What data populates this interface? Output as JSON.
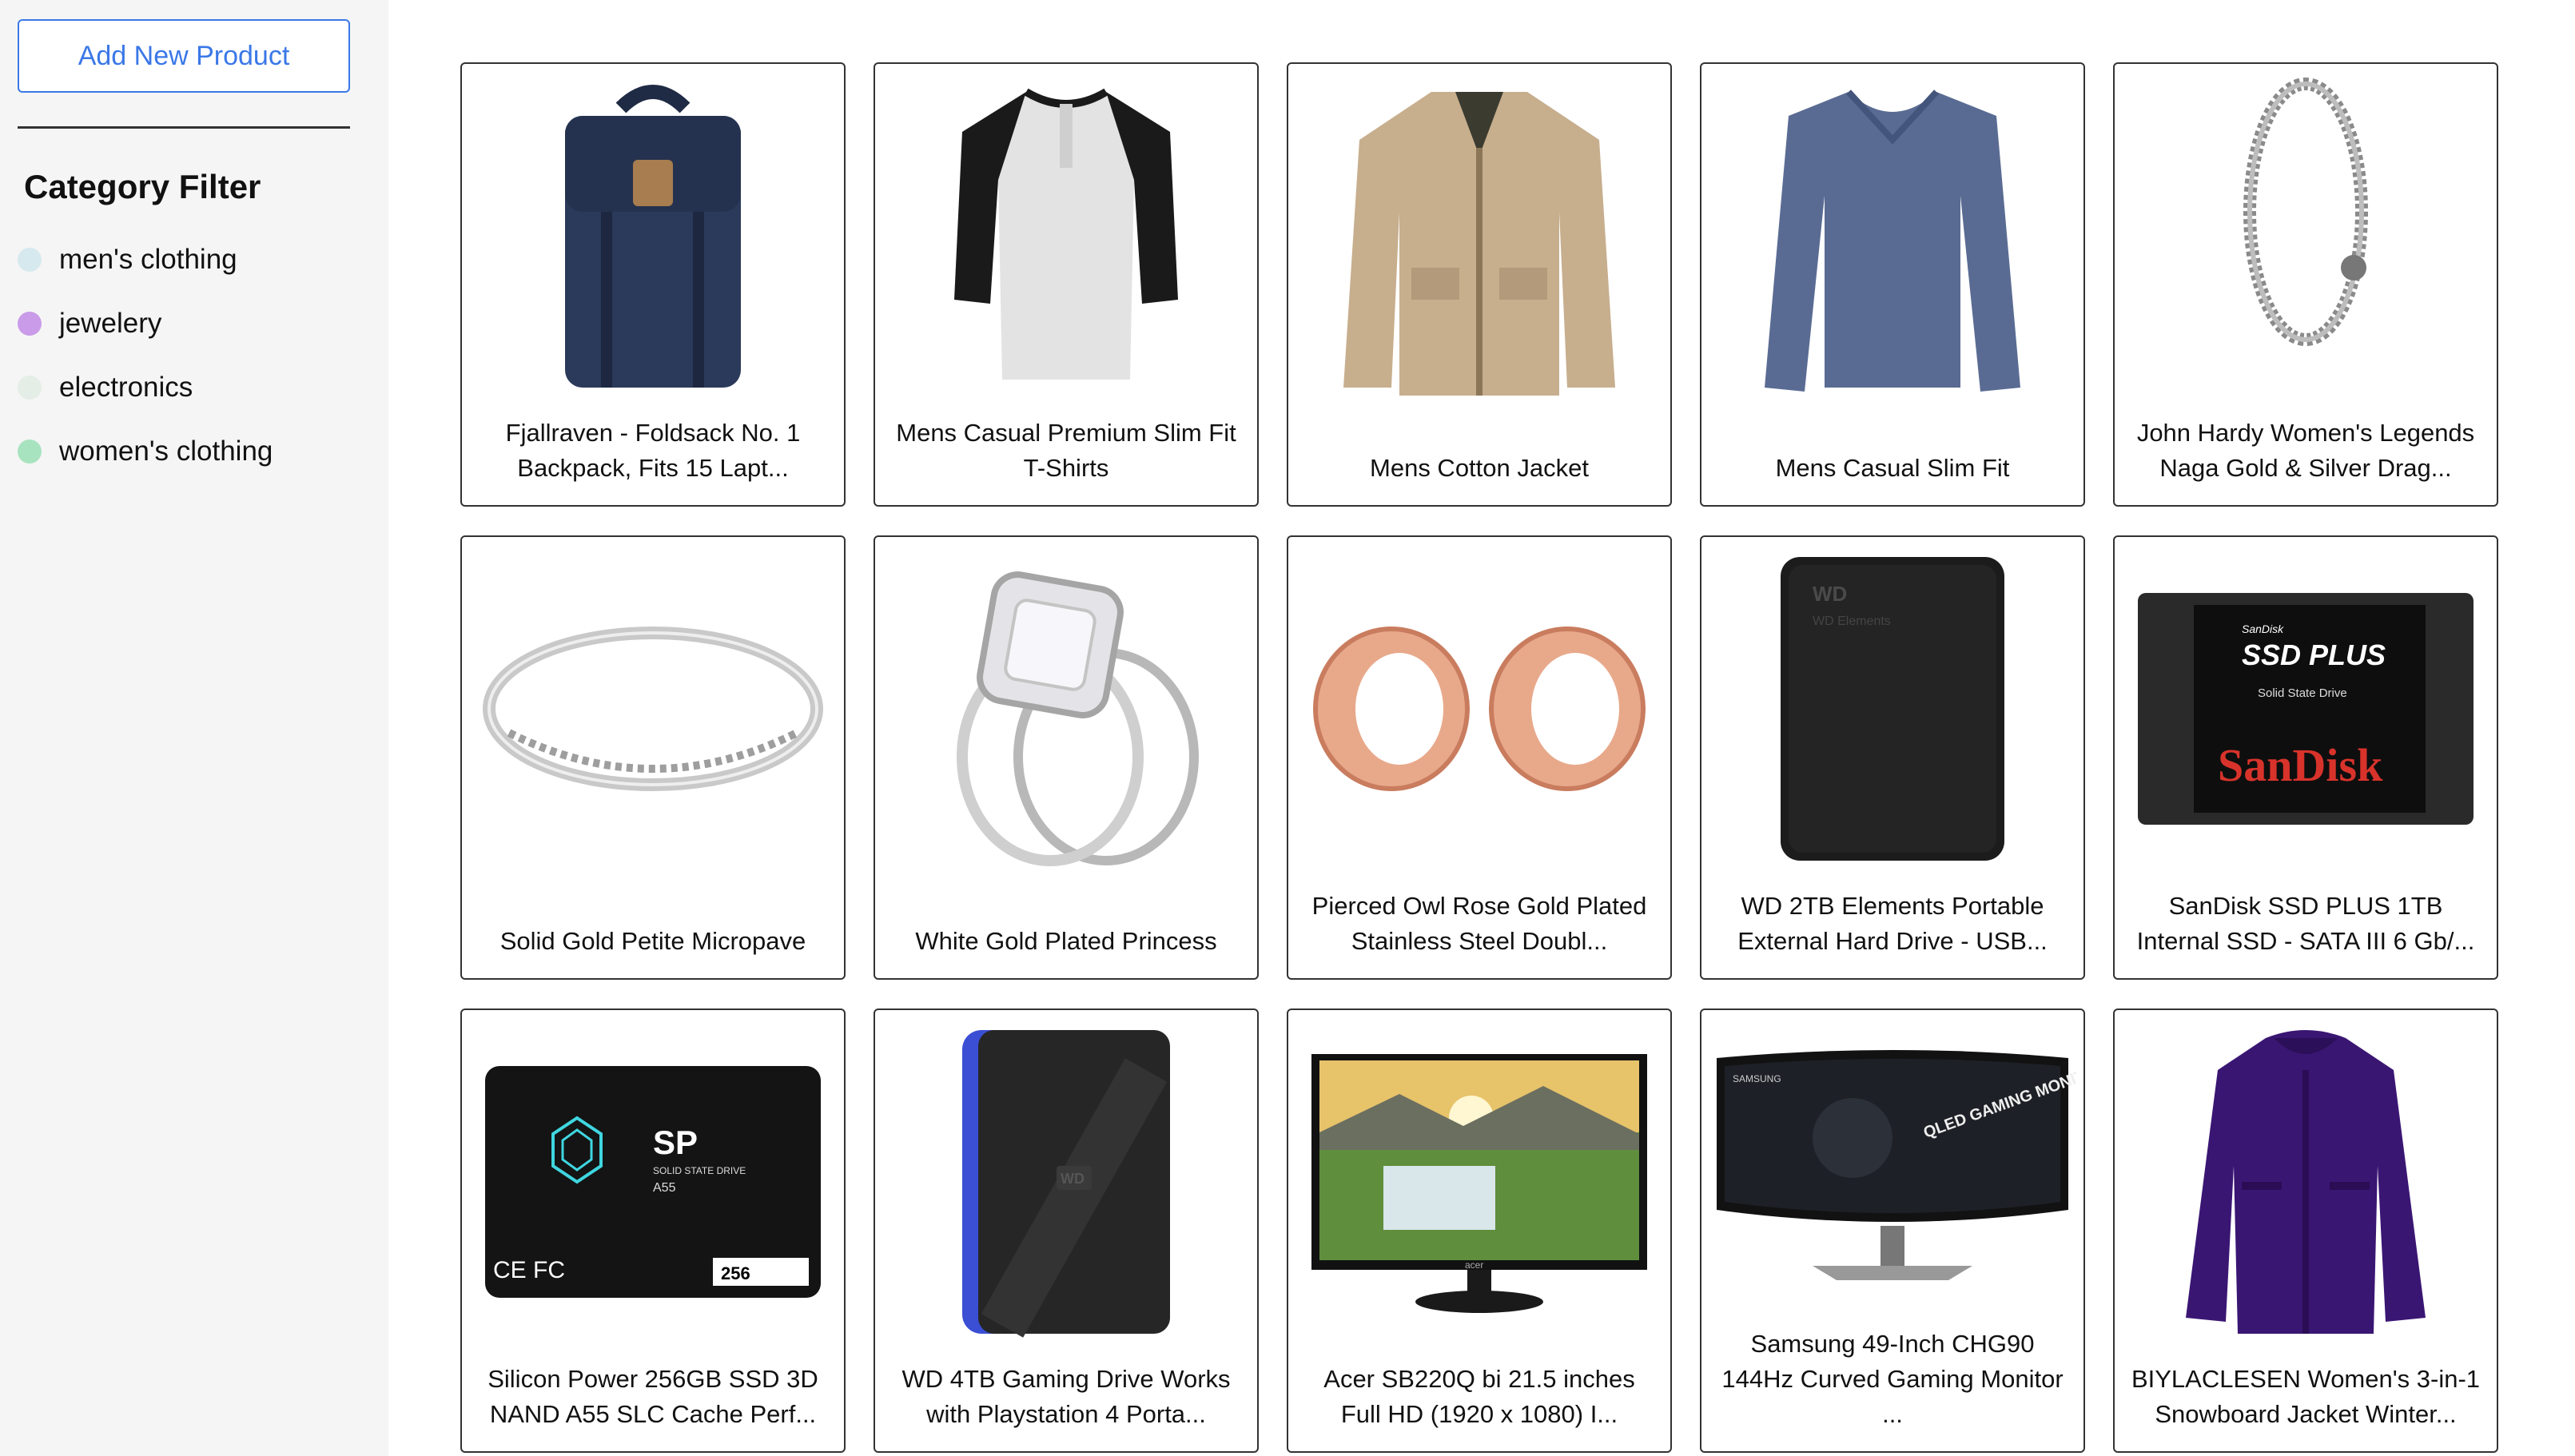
{
  "sidebar": {
    "add_button": "Add New Product",
    "filter_title": "Category Filter",
    "categories": [
      {
        "label": "men's clothing",
        "color": "#d6e9ee"
      },
      {
        "label": "jewelery",
        "color": "#c99be8"
      },
      {
        "label": "electronics",
        "color": "#e4eee6"
      },
      {
        "label": "women's clothing",
        "color": "#a8e3bf"
      }
    ]
  },
  "products": [
    {
      "title": "Fjallraven - Foldsack No. 1 Backpack, Fits 15 Lapt...",
      "icon": "backpack-icon"
    },
    {
      "title": "Mens Casual Premium Slim Fit T-Shirts",
      "icon": "tshirt-icon"
    },
    {
      "title": "Mens Cotton Jacket",
      "icon": "jacket-icon"
    },
    {
      "title": "Mens Casual Slim Fit",
      "icon": "longsleeve-icon"
    },
    {
      "title": "John Hardy Women's Legends Naga Gold & Silver Drag...",
      "icon": "bracelet-icon"
    },
    {
      "title": "Solid Gold Petite Micropave",
      "icon": "ring-icon"
    },
    {
      "title": "White Gold Plated Princess",
      "icon": "diamond-ring-icon"
    },
    {
      "title": "Pierced Owl Rose Gold Plated Stainless Steel Doubl...",
      "icon": "ear-tunnels-icon"
    },
    {
      "title": "WD 2TB Elements Portable External Hard Drive - USB...",
      "icon": "hard-drive-icon"
    },
    {
      "title": "SanDisk SSD PLUS 1TB Internal SSD - SATA III 6 Gb/...",
      "icon": "ssd-icon"
    },
    {
      "title": "Silicon Power 256GB SSD 3D NAND A55 SLC Cache Perf...",
      "icon": "ssd-icon"
    },
    {
      "title": "WD 4TB Gaming Drive Works with Playstation 4 Porta...",
      "icon": "gaming-drive-icon"
    },
    {
      "title": "Acer SB220Q bi 21.5 inches Full HD (1920 x 1080) I...",
      "icon": "monitor-icon"
    },
    {
      "title": "Samsung 49-Inch CHG90 144Hz Curved Gaming Monitor ...",
      "icon": "curved-monitor-icon"
    },
    {
      "title": "BIYLACLESEN Women's 3-in-1 Snowboard Jacket Winter...",
      "icon": "womens-jacket-icon"
    }
  ],
  "images": {
    "sandisk_small": "SanDisk",
    "sandisk_plus": "SSD PLUS",
    "sandisk_sub": "Solid State Drive",
    "sandisk_logo": "SanDisk",
    "sp_logo": "SP",
    "sp_sub": "SOLID STATE DRIVE",
    "sp_model": "A55",
    "sp_cap": "256",
    "sp_marks": "CE FC",
    "wd_logo": "WD",
    "wd_elements": "WD Elements",
    "acer_logo": "acer",
    "samsung_logo": "SAMSUNG",
    "qled_text": "QLED GAMING MONITOR"
  }
}
